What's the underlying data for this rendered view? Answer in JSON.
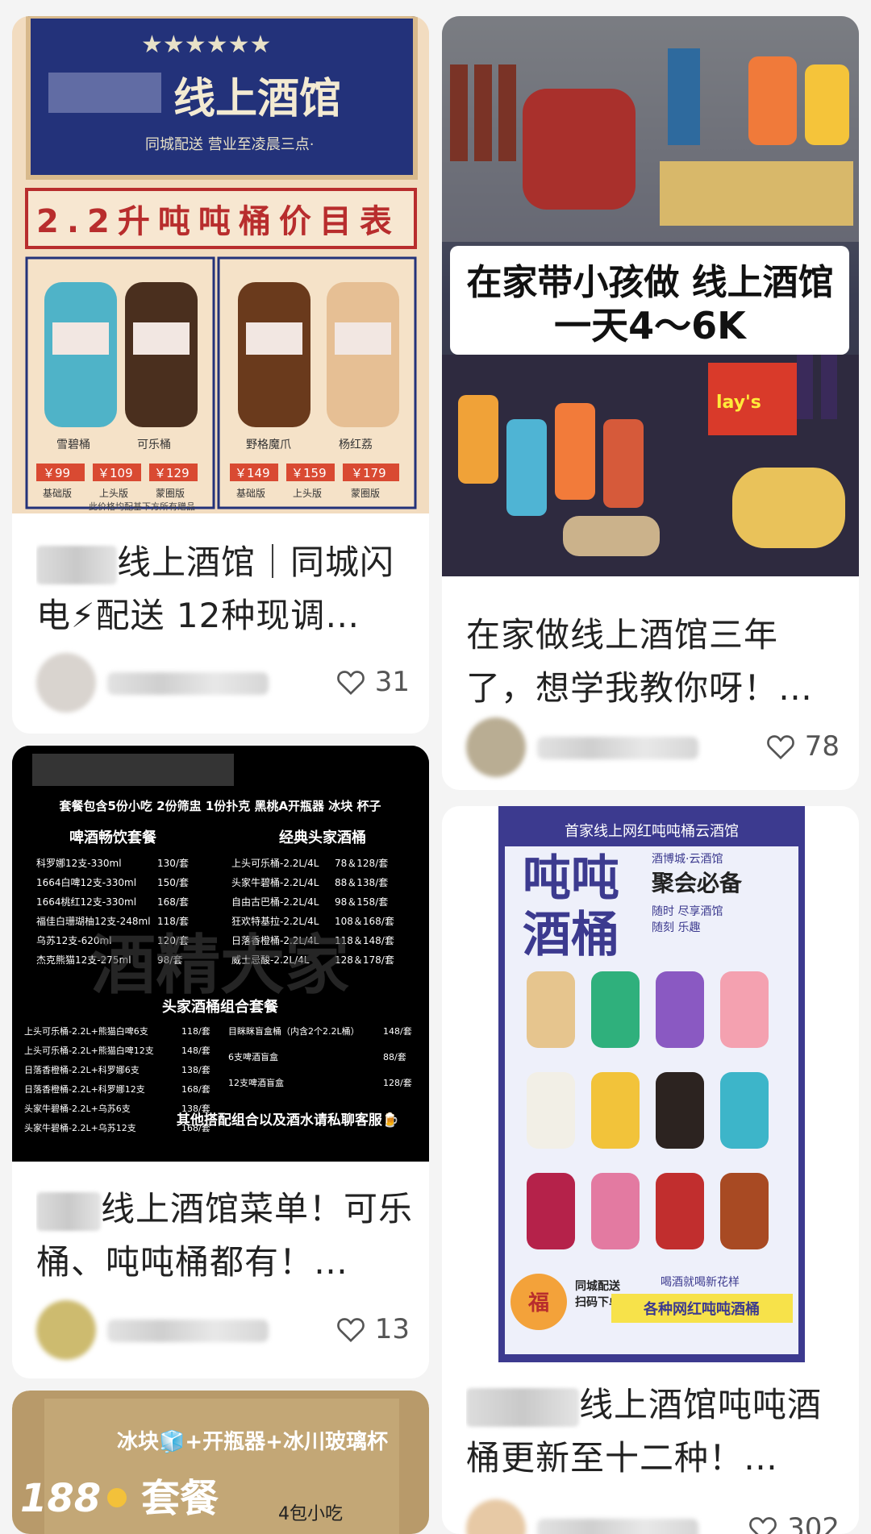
{
  "cards": [
    {
      "title": "线上酒馆｜同城闪电⚡配送 12种现调…",
      "likes": "31",
      "image": {
        "brand": "线上酒馆",
        "sub": "同城配送 营业至凌晨三点·",
        "stars": "★★★★★★",
        "menu_title": "2.2升吨吨桶价目表",
        "products": [
          {
            "name": "雪碧桶",
            "price": "￥99",
            "tier": "基础版"
          },
          {
            "name": "可乐桶",
            "price": "￥109",
            "tier": "上头版"
          },
          {
            "name": "野格魔爪",
            "price": "￥129",
            "tier": "蒙圈版"
          },
          {
            "name": "杨红荔",
            "price": "￥149",
            "tier": "基础版"
          },
          {
            "name": "",
            "price": "￥159",
            "tier": "上头版"
          },
          {
            "name": "",
            "price": "￥179",
            "tier": "蒙圈版"
          }
        ],
        "footnote": "此价格均配基下方所有赠品"
      }
    },
    {
      "title": "在家做线上酒馆三年了，想学我教你呀！…",
      "likes": "78",
      "image": {
        "banner_line1": "在家带小孩做 线上酒馆",
        "banner_line2": "一天4～6K",
        "chip_brand": "lay's"
      }
    },
    {
      "title": "线上酒馆菜单！可乐桶、吨吨桶都有！…",
      "likes": "13",
      "image": {
        "top": "套餐包含5份小吃 2份筛盅 1份扑克 黑桃A开瓶器 冰块 杯子",
        "sec1": "啤酒畅饮套餐",
        "sec2": "经典头家酒桶",
        "left_items": [
          [
            "科罗娜12支-330ml",
            "130/套"
          ],
          [
            "1664白啤12支-330ml",
            "150/套"
          ],
          [
            "1664桃红12支-330ml",
            "168/套"
          ],
          [
            "福佳白珊瑚柚12支-248ml",
            "118/套"
          ],
          [
            "乌苏12支-620ml",
            "120/套"
          ],
          [
            "杰克熊猫12支-275ml",
            "98/套"
          ]
        ],
        "right_items": [
          [
            "上头可乐桶-2.2L/4L",
            "78＆128/套"
          ],
          [
            "头家牛碧桶-2.2L/4L",
            "88＆138/套"
          ],
          [
            "自由古巴桶-2.2L/4L",
            "98＆158/套"
          ],
          [
            "狂欢特基拉-2.2L/4L",
            "108＆168/套"
          ],
          [
            "日落香橙桶-2.2L/4L",
            "118＆148/套"
          ],
          [
            "威士忌酸-2.2L/4L",
            "128＆178/套"
          ]
        ],
        "watermark": "酒精大家",
        "sec3": "头家酒桶组合套餐",
        "combo_left": [
          [
            "上头可乐桶-2.2L+熊猫白啤6支",
            "118/套"
          ],
          [
            "上头可乐桶-2.2L+熊猫白啤12支",
            "148/套"
          ],
          [
            "日落香橙桶-2.2L+科罗娜6支",
            "138/套"
          ],
          [
            "日落香橙桶-2.2L+科罗娜12支",
            "168/套"
          ],
          [
            "头家牛碧桶-2.2L+乌苏6支",
            "138/套"
          ],
          [
            "头家牛碧桶-2.2L+乌苏12支",
            "168/套"
          ]
        ],
        "combo_right": [
          [
            "目眯眯盲盒桶（内含2个2.2L桶）",
            "148/套"
          ],
          [
            "6支啤酒盲盒",
            "88/套"
          ],
          [
            "12支啤酒盲盒",
            "128/套"
          ]
        ],
        "footer": "其他搭配组合以及酒水请私聊客服🍺"
      }
    },
    {
      "title": "线上酒馆吨吨酒桶更新至十二种！…",
      "likes": "302",
      "image": {
        "header": "首家线上网红吨吨桶云酒馆",
        "big1": "吨吨",
        "big2": "酒桶",
        "tag": "酒博城·云酒馆",
        "slogan": "聚会必备",
        "sub1": "随时 尽享酒馆",
        "sub2": "随刻 乐趣",
        "side": "同城配送",
        "side2": "扫码下单",
        "bottom_tag": "喝酒就喝新花样",
        "bottom_main": "各种网红吨吨酒桶",
        "tiger": "福"
      }
    },
    {
      "title": "",
      "likes": "",
      "image": {
        "line1": "冰块🧊+开瓶器+冰川玻璃杯",
        "price": "188",
        "label": "套餐",
        "small": "4包小吃"
      }
    }
  ],
  "colors": {
    "navy": "#23327a",
    "cream": "#f3ddc1",
    "red": "#b82d2d",
    "purple": "#3c3a8f"
  }
}
